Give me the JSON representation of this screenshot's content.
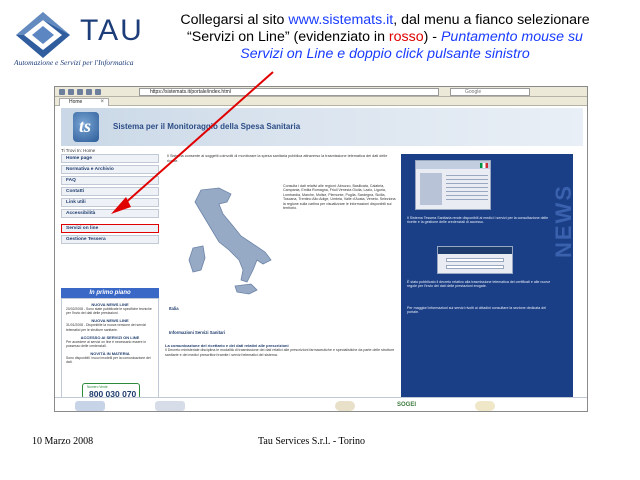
{
  "logo": {
    "word": "TAU",
    "tagline": "Automazione e Servizi per l'Informatica",
    "registered": "®"
  },
  "instructions": {
    "line1_prefix": "Collegarsi al sito ",
    "site": "www.sistemats.it",
    "line1_suffix": ", dal menu a fianco selezionare",
    "line2_prefix": "“Servizi on Line” (evidenziato in ",
    "red_word": "rosso",
    "line2_suffix": ") - ",
    "italic_part1": "Puntamento mouse su",
    "italic_part2": "Servizi on Line e doppio click pulsante sinistro"
  },
  "browser": {
    "url": "https://sistemats.it/portale/index.html",
    "search_placeholder": "Google",
    "tab_label": "Home",
    "page": {
      "banner_logo": "ts",
      "banner_title": "Sistema per il Monitoraggio della Spesa Sanitaria",
      "breadcrumb": "Ti Trovi In: Home",
      "nav_items": [
        {
          "label": "Home page"
        },
        {
          "label": "Normativa e Archivio"
        },
        {
          "label": "FAQ"
        },
        {
          "label": "Contatti"
        },
        {
          "label": "Link utili"
        },
        {
          "label": "Accessibilità"
        },
        {
          "label": "Servizi on line",
          "highlight": true
        },
        {
          "label": "Gestione Tessera"
        }
      ],
      "in_primo_piano": "In primo piano",
      "news_left": [
        {
          "title": "NUOVA NEWS LINE",
          "text": "20/02/2008 - Sono state pubblicate le specifiche tecniche per l'invio dei dati delle prestazioni."
        },
        {
          "title": "NUOVA NEWS LINE",
          "text": "31/01/2008 - Disponibile la nuova versione dei servizi telematici per le strutture sanitarie."
        },
        {
          "title": "ACCESSO AI SERVIZI ON LINE",
          "text": "Per accedere ai servizi on line è necessario essere in possesso delle credenziali."
        },
        {
          "title": "NOVITÀ IN MATERIA",
          "text": "Sono disponibili i nuovi modelli per la comunicazione dei dati."
        }
      ],
      "phone_label": "Numero Verde",
      "phone": "800 030 070",
      "intro": "Il Sistema consente ai soggetti coinvolti di monitorare la spesa sanitaria pubblica attraverso la trasmissione telematica dei dati delle ricette.",
      "map_text": "Consulta i dati relativi alle regioni: Abruzzo, Basilicata, Calabria, Campania, Emilia Romagna, Friuli Venezia Giulia, Lazio, Liguria, Lombardia, Marche, Molise, Piemonte, Puglia, Sardegna, Sicilia, Toscana, Trentino Alto Adige, Umbria, Valle d'Aosta, Veneto. Seleziona la regione sulla cartina per visualizzare le informazioni disponibili sul territorio.",
      "italia_label": "Italia",
      "info_link": "Informazioni Servizi Sanitari",
      "lower_heading": "La comunicazione del ricettario e dei dati relativi alle prescrizioni",
      "lower_text": "Il Decreto ministeriale disciplina le modalità di trasmissione dei dati relativi alle prescrizioni farmaceutiche e specialistiche da parte delle strutture sanitarie e dei medici prescrittori tramite i servizi telematici del sistema.",
      "news_right": [
        "Il Sistema Tessera Sanitaria rende disponibili ai medici i servizi per la consultazione delle ricette e la gestione delle credenziali di accesso.",
        "È stato pubblicato il decreto relativo alla trasmissione telematica dei certificati e alle nuove regole per l'invio dei dati delle prestazioni erogate.",
        "Per maggiori informazioni sui servizi rivolti ai cittadini consultare la sezione dedicata del portale."
      ],
      "news_watermark": "NEWS",
      "footer_logo": "SOGEI"
    }
  },
  "footer": {
    "date": "10 Marzo 2008",
    "company": "Tau Services S.r.l. - Torino"
  },
  "colors": {
    "brand_blue": "#1d3d7a",
    "link_blue": "#1a3cff",
    "highlight_red": "#e00000",
    "news_panel": "#1b3f86"
  }
}
